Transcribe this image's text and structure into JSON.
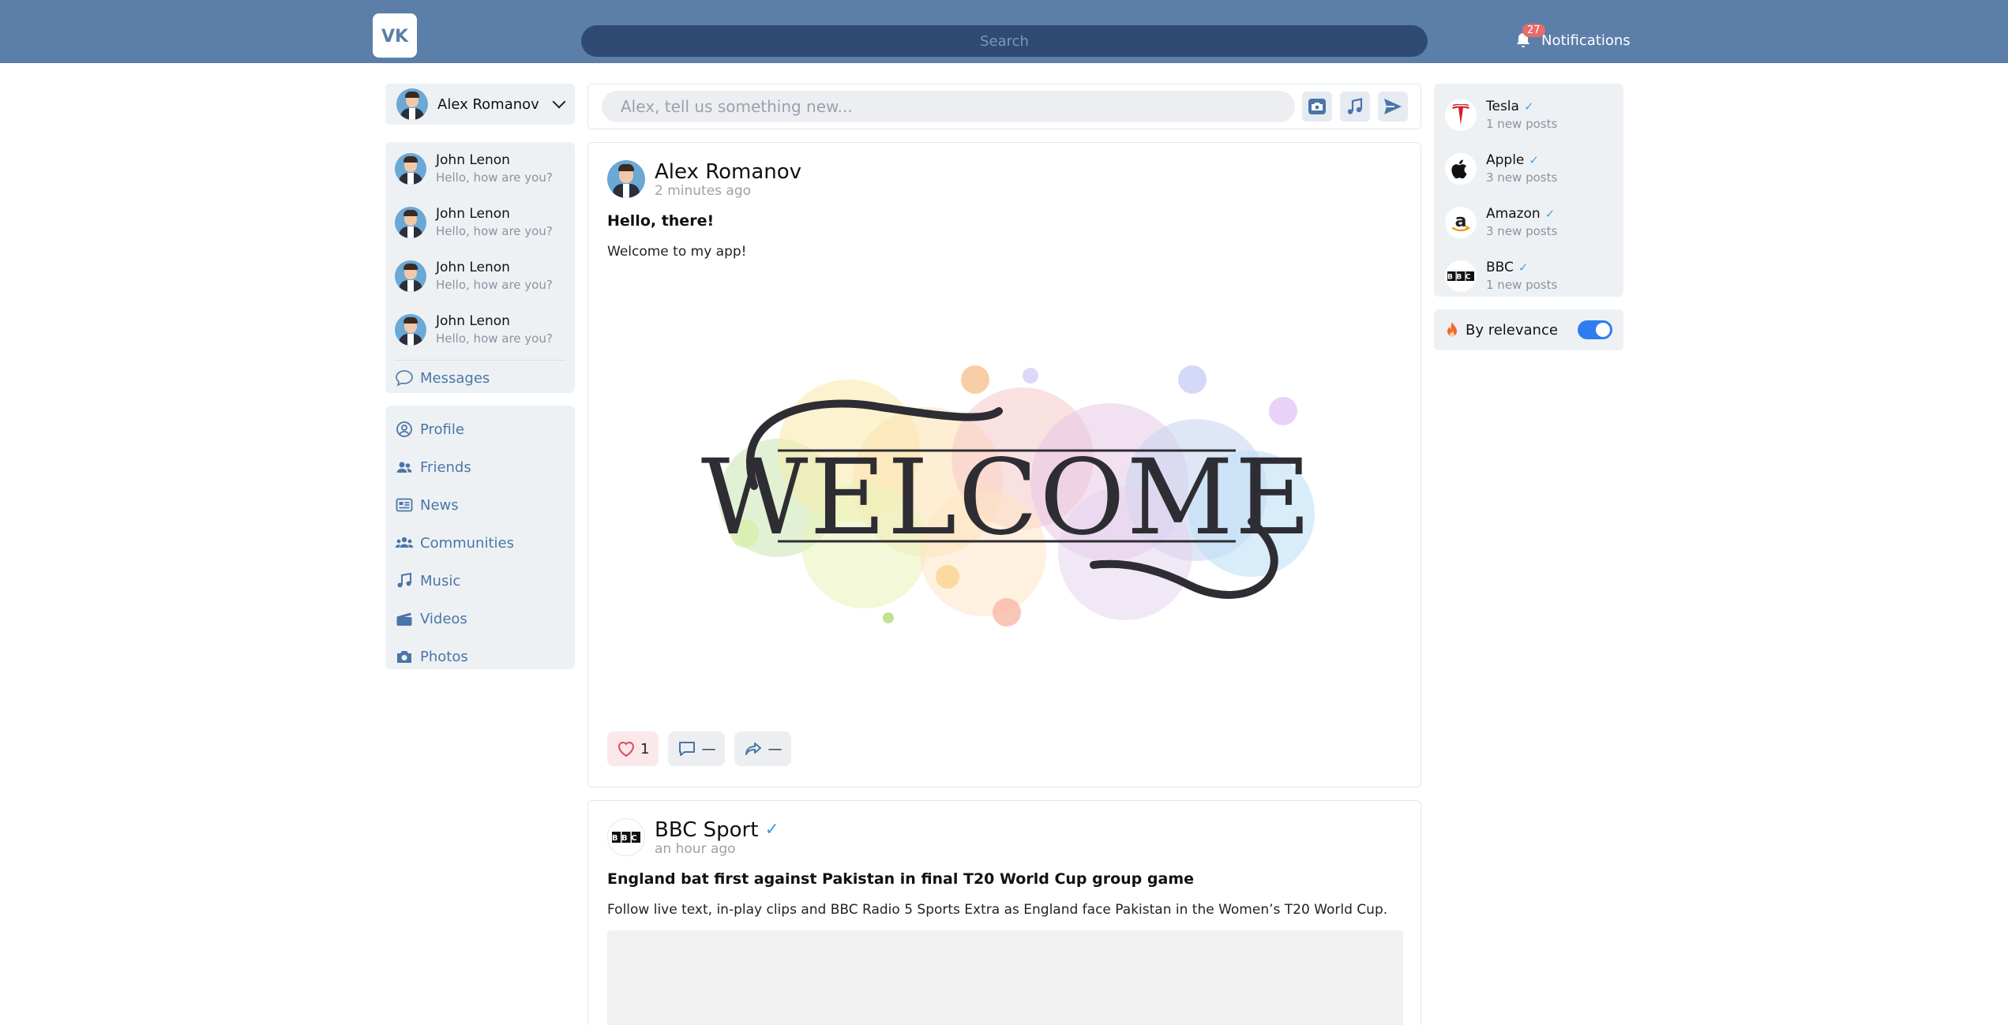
{
  "header": {
    "logo": "VK",
    "search_placeholder": "Search",
    "notifications": {
      "count": "27",
      "label": "Notifications"
    }
  },
  "user_selector": {
    "name": "Alex Romanov"
  },
  "messages": {
    "items": [
      {
        "name": "John Lenon",
        "preview": "Hello, how are you?"
      },
      {
        "name": "John Lenon",
        "preview": "Hello, how are you?"
      },
      {
        "name": "John Lenon",
        "preview": "Hello, how are you?"
      },
      {
        "name": "John Lenon",
        "preview": "Hello, how are you?"
      }
    ],
    "link_label": "Messages"
  },
  "nav": {
    "items": [
      {
        "label": "Profile",
        "icon": "user-circle-icon"
      },
      {
        "label": "Friends",
        "icon": "friends-icon"
      },
      {
        "label": "News",
        "icon": "newspaper-icon"
      },
      {
        "label": "Communities",
        "icon": "communities-icon"
      },
      {
        "label": "Music",
        "icon": "music-icon"
      },
      {
        "label": "Videos",
        "icon": "clapperboard-icon"
      },
      {
        "label": "Photos",
        "icon": "camera-icon"
      }
    ]
  },
  "composer": {
    "placeholder": "Alex, tell us something new..."
  },
  "posts": [
    {
      "author": "Alex Romanov",
      "time": "2 minutes ago",
      "title": "Hello, there!",
      "body": "Welcome to my app!",
      "image_text": "WELCOME",
      "likes": "1",
      "comments": "—",
      "shares": "—"
    },
    {
      "author": "BBC Sport",
      "logo_text": "BBC",
      "verified": true,
      "time": "an hour ago",
      "title": "England bat first against Pakistan in final T20 World Cup group game",
      "body": "Follow live text, in-play clips and BBC Radio 5 Sports Extra as England face Pakistan in the Women’s T20 World Cup."
    }
  ],
  "feeds": [
    {
      "name": "Tesla",
      "sub": "1 new posts",
      "logo": "tesla-logo"
    },
    {
      "name": "Apple",
      "sub": "3 new posts",
      "logo": "apple-logo"
    },
    {
      "name": "Amazon",
      "sub": "3 new posts",
      "logo": "amazon-logo"
    },
    {
      "name": "BBC",
      "sub": "1 new posts",
      "logo": "bbc-logo",
      "logo_text": "BBC"
    }
  ],
  "relevance": {
    "label": "By relevance",
    "enabled": true
  },
  "colors": {
    "header": "#5b7fa8",
    "accent": "#4a76a8",
    "badge": "#e66b6b",
    "toggle": "#2f7cf0"
  }
}
